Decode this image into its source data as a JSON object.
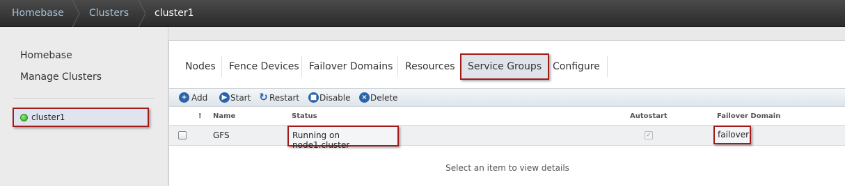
{
  "breadcrumb": {
    "items": [
      "Homebase",
      "Clusters",
      "cluster1"
    ]
  },
  "sidebar": {
    "links": [
      "Homebase",
      "Manage Clusters"
    ],
    "cluster": {
      "name": "cluster1",
      "status_color": "#3cc02a"
    }
  },
  "tabs": [
    "Nodes",
    "Fence Devices",
    "Failover Domains",
    "Resources",
    "Service Groups",
    "Configure"
  ],
  "active_tab": "Service Groups",
  "toolbar": {
    "add": "Add",
    "start": "Start",
    "restart": "Restart",
    "disable": "Disable",
    "delete": "Delete",
    "icons": [
      "plus-icon",
      "play-icon",
      "refresh-icon",
      "stop-icon",
      "x-icon"
    ]
  },
  "table": {
    "columns": {
      "flag": "!",
      "name": "Name",
      "status": "Status",
      "autostart": "Autostart",
      "failover": "Failover Domain"
    },
    "rows": [
      {
        "name": "GFS",
        "status": "Running on node1.cluster",
        "autostart": true,
        "failover": "failover"
      }
    ]
  },
  "details_placeholder": "Select an item to view details",
  "colors": {
    "highlight_border": "#a31a1a",
    "link": "#a9c3d6",
    "accent": "#2a64a8"
  }
}
